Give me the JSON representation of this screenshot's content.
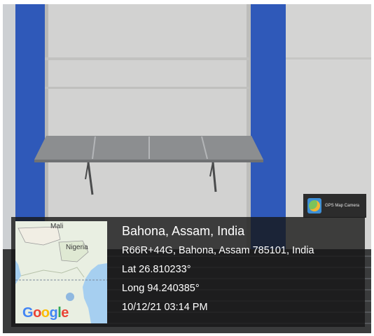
{
  "photo": {
    "subject": "solar-panel-icon",
    "colors": {
      "wall": "#d2d2d1",
      "pillar_blue": "#2f59b9",
      "panel": "#888a8c",
      "roof": "#3a3b3c"
    }
  },
  "stamp": {
    "app_logo_text": "GPS Map Camera",
    "map": {
      "label_mali": "Mali",
      "label_nigeria": "Nigeria",
      "google_logo": "Google"
    },
    "place": "Bahona, Assam, India",
    "address": "R66R+44G, Bahona, Assam 785101, India",
    "lat": "Lat 26.810233°",
    "long": "Long 94.240385°",
    "datetime": "10/12/21 03:14 PM"
  }
}
